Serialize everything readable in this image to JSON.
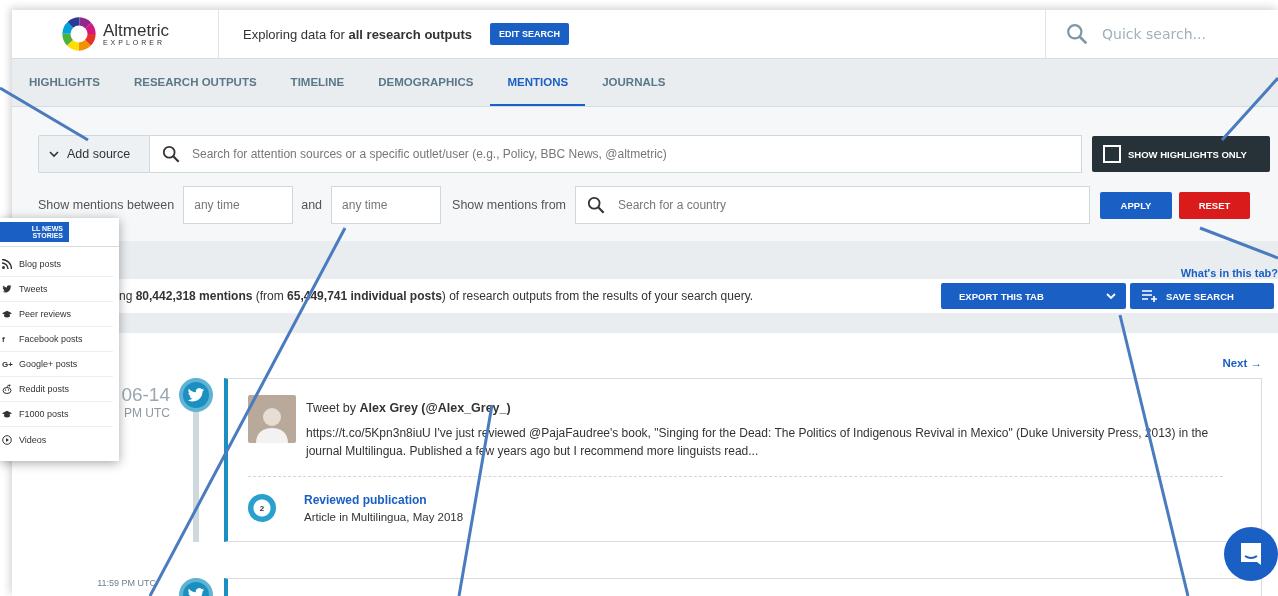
{
  "header": {
    "logo_title": "Altmetric",
    "logo_subtitle": "EXPLORER",
    "scope_text": "Exploring data for **all research outputs**",
    "edit_button": "EDIT SEARCH",
    "quick_search": {
      "placeholder": "Quick search..."
    }
  },
  "tabs": [
    {
      "label": "HIGHLIGHTS",
      "selected": false
    },
    {
      "label": "RESEARCH OUTPUTS",
      "selected": false
    },
    {
      "label": "TIMELINE",
      "selected": false
    },
    {
      "label": "DEMOGRAPHICS",
      "selected": false
    },
    {
      "label": "MENTIONS",
      "selected": true
    },
    {
      "label": "JOURNALS",
      "selected": false
    }
  ],
  "filters": {
    "add_source": "Add source",
    "source_search": {
      "placeholder": "Search for attention sources or a specific outlet/user (e.g., Policy, BBC News, @altmetric)"
    },
    "highlights_only": {
      "label": "SHOW HIGHLIGHTS ONLY",
      "checked": false
    },
    "between_label": "Show mentions between",
    "from_date": {
      "placeholder": "any time"
    },
    "and_label": "and",
    "to_date": {
      "placeholder": "any time"
    },
    "from_label": "Show mentions from",
    "country_search": {
      "placeholder": "Search for a country"
    },
    "apply": "APPLY",
    "reset": "RESET"
  },
  "results": {
    "help_link": "What's in this tab?",
    "summary": "ng **80,442,318 mentions** (from **65,449,741 individual posts**) of research outputs from the results of your search query.",
    "export_button": "EXPORT THIS TAB",
    "save_button": "SAVE SEARCH"
  },
  "timeline": {
    "next_link": "Next →",
    "mentions": [
      {
        "kind": "tweet",
        "date": "06-14",
        "time": "PM UTC",
        "byline": "Tweet by **Alex Grey (@Alex_Grey_)**",
        "text": "https://t.co/5Kpn3n8iuU I've just reviewed @PajaFaudree's book, \"Singing for the Dead: The Politics of Indigenous Revival in Mexico\" (Duke University Press, 2013) in the journal Multilingua. Published a few years ago but I recommend more linguists read...",
        "output": {
          "score": "2",
          "title": "Reviewed publication",
          "subtitle": "Article in Multilingua, May 2018"
        }
      },
      {
        "kind": "tweet",
        "time": "11:59 PM UTC"
      }
    ]
  },
  "source_menu": {
    "header_button": "LL NEWS STORIES",
    "items": [
      {
        "kind": "rss",
        "label": "Blog posts"
      },
      {
        "kind": "bird",
        "label": "Tweets"
      },
      {
        "kind": "cap",
        "label": "Peer reviews"
      },
      {
        "kind": "glyph",
        "glyph": "f",
        "label": "Facebook posts"
      },
      {
        "kind": "glyph",
        "glyph": "G+",
        "label": "Google+ posts"
      },
      {
        "kind": "reddit",
        "label": "Reddit posts"
      },
      {
        "kind": "cap",
        "label": "F1000 posts"
      },
      {
        "kind": "play",
        "label": "Videos"
      }
    ]
  }
}
